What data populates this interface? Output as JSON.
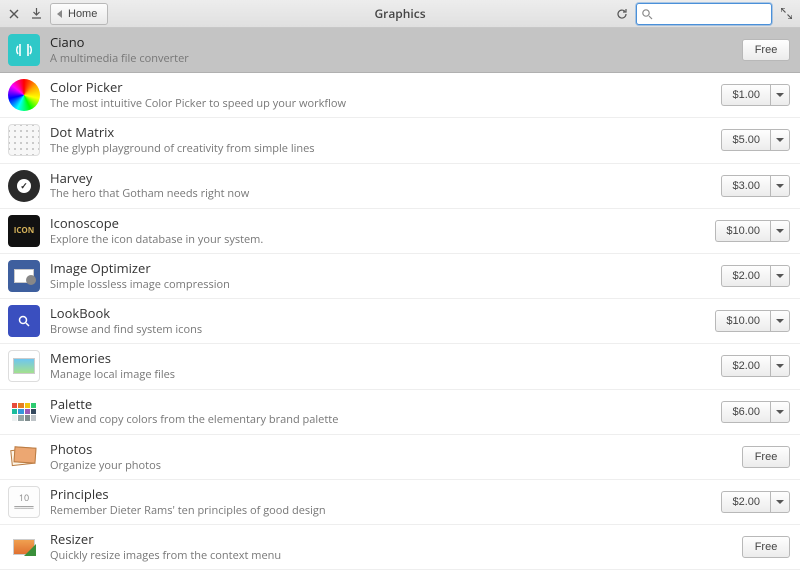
{
  "header": {
    "title": "Graphics",
    "home_label": "Home",
    "search_value": ""
  },
  "apps": [
    {
      "id": "ciano",
      "name": "Ciano",
      "desc": "A multimedia file converter",
      "price": "Free",
      "has_dropdown": false,
      "selected": true
    },
    {
      "id": "colorpicker",
      "name": "Color Picker",
      "desc": "The most intuitive Color Picker to speed up your workflow",
      "price": "$1.00",
      "has_dropdown": true,
      "selected": false
    },
    {
      "id": "dotmatrix",
      "name": "Dot Matrix",
      "desc": "The glyph playground of creativity from simple lines",
      "price": "$5.00",
      "has_dropdown": true,
      "selected": false
    },
    {
      "id": "harvey",
      "name": "Harvey",
      "desc": "The hero that Gotham needs right now",
      "price": "$3.00",
      "has_dropdown": true,
      "selected": false
    },
    {
      "id": "iconoscope",
      "name": "Iconoscope",
      "desc": "Explore the icon database in your system.",
      "price": "$10.00",
      "has_dropdown": true,
      "selected": false
    },
    {
      "id": "imageopt",
      "name": "Image Optimizer",
      "desc": "Simple lossless image compression",
      "price": "$2.00",
      "has_dropdown": true,
      "selected": false
    },
    {
      "id": "lookbook",
      "name": "LookBook",
      "desc": "Browse and find system icons",
      "price": "$10.00",
      "has_dropdown": true,
      "selected": false
    },
    {
      "id": "memories",
      "name": "Memories",
      "desc": "Manage local image files",
      "price": "$2.00",
      "has_dropdown": true,
      "selected": false
    },
    {
      "id": "palette",
      "name": "Palette",
      "desc": "View and copy colors from the elementary brand palette",
      "price": "$6.00",
      "has_dropdown": true,
      "selected": false
    },
    {
      "id": "photos",
      "name": "Photos",
      "desc": "Organize your photos",
      "price": "Free",
      "has_dropdown": false,
      "selected": false
    },
    {
      "id": "principles",
      "name": "Principles",
      "desc": "Remember Dieter Rams' ten principles of good design",
      "price": "$2.00",
      "has_dropdown": true,
      "selected": false
    },
    {
      "id": "resizer",
      "name": "Resizer",
      "desc": "Quickly resize images from the context menu",
      "price": "Free",
      "has_dropdown": false,
      "selected": false
    }
  ]
}
